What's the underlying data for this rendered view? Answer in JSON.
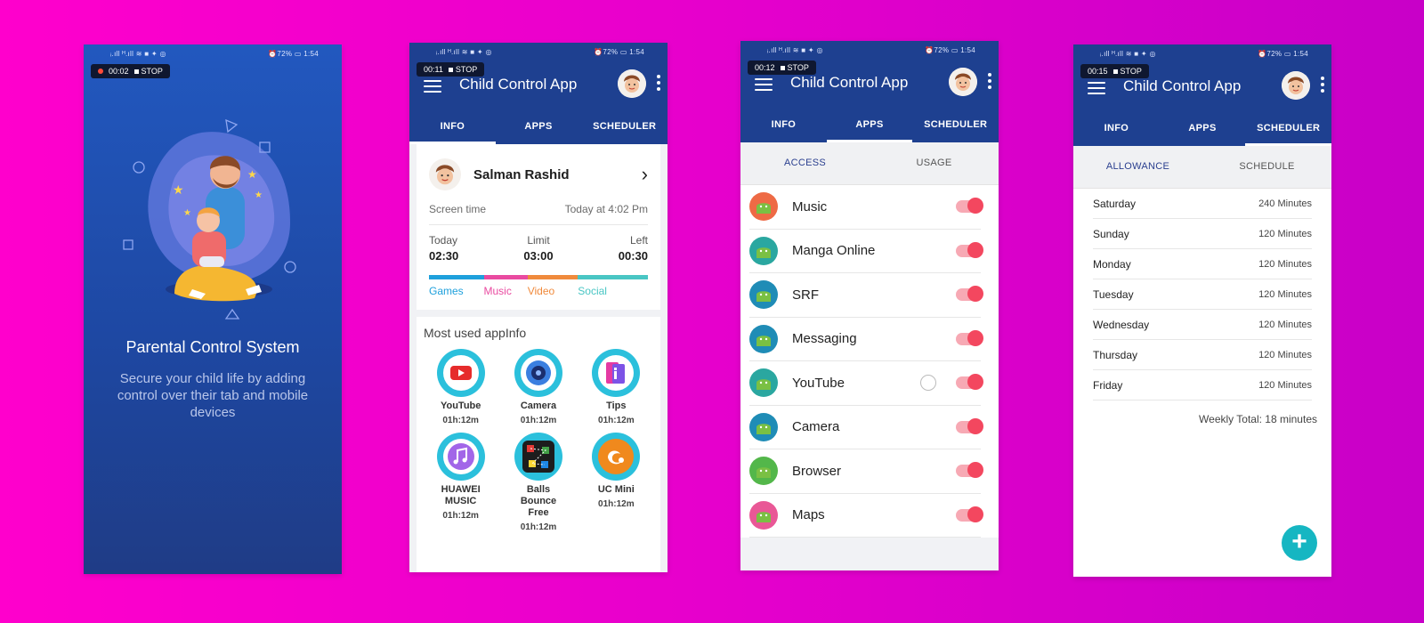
{
  "status_bar": {
    "left_icons": "ᵢ.ıll ᴴ.ıll ≋ ■ ✦ ◎",
    "battery": "⏰72% ▭ 1:54"
  },
  "screens": {
    "splash": {
      "recording": {
        "time": "00:02",
        "stop": "STOP"
      },
      "title": "Parental Control System",
      "subtitle": "Secure your child life by adding control over their tab and mobile devices"
    },
    "info": {
      "recording": {
        "time": "00:11",
        "stop": "STOP"
      },
      "app_title": "Child Control App",
      "tabs": [
        "INFO",
        "APPS",
        "SCHEDULER"
      ],
      "profile_name": "Salman Rashid",
      "screen_time_label": "Screen time",
      "screen_time_value": "Today at 4:02 Pm",
      "usage": {
        "today_label": "Today",
        "today_value": "02:30",
        "limit_label": "Limit",
        "limit_value": "03:00",
        "left_label": "Left",
        "left_value": "00:30"
      },
      "categories": [
        {
          "label": "Games",
          "color": "#1ea0dc"
        },
        {
          "label": "Music",
          "color": "#e94aa0"
        },
        {
          "label": "Video",
          "color": "#f08a3c"
        },
        {
          "label": "Social",
          "color": "#49c6c4"
        }
      ],
      "most_used_title": "Most used appInfo",
      "apps": [
        {
          "name": "YouTube",
          "time": "01h:12m",
          "icon": "youtube-icon"
        },
        {
          "name": "Camera",
          "time": "01h:12m",
          "icon": "camera-icon"
        },
        {
          "name": "Tips",
          "time": "01h:12m",
          "icon": "tips-icon"
        },
        {
          "name": "HUAWEI MUSIC",
          "time": "01h:12m",
          "icon": "music-icon"
        },
        {
          "name": "Balls Bounce Free",
          "time": "01h:12m",
          "icon": "balls-icon"
        },
        {
          "name": "UC Mini",
          "time": "01h:12m",
          "icon": "uc-mini-icon"
        }
      ]
    },
    "apps": {
      "recording": {
        "time": "00:12",
        "stop": "STOP"
      },
      "app_title": "Child Control App",
      "tabs": [
        "INFO",
        "APPS",
        "SCHEDULER"
      ],
      "subtabs": [
        "ACCESS",
        "USAGE"
      ],
      "list": [
        {
          "name": "Music",
          "color": "#ee6a45"
        },
        {
          "name": "Manga Online",
          "color": "#2aa7a0"
        },
        {
          "name": "SRF",
          "color": "#1f8cb6"
        },
        {
          "name": "Messaging",
          "color": "#1f8cb6"
        },
        {
          "name": "YouTube",
          "color": "#2aa7a0"
        },
        {
          "name": "Camera",
          "color": "#1f8cb6"
        },
        {
          "name": "Browser",
          "color": "#53b74a"
        },
        {
          "name": "Maps",
          "color": "#e95896"
        }
      ]
    },
    "scheduler": {
      "recording": {
        "time": "00:15",
        "stop": "STOP"
      },
      "app_title": "Child Control App",
      "tabs": [
        "INFO",
        "APPS",
        "SCHEDULER"
      ],
      "subtabs": [
        "ALLOWANCE",
        "SCHEDULE"
      ],
      "days": [
        {
          "day": "Saturday",
          "value": "240 Minutes"
        },
        {
          "day": "Sunday",
          "value": "120 Minutes"
        },
        {
          "day": "Monday",
          "value": "120 Minutes"
        },
        {
          "day": "Tuesday",
          "value": "120 Minutes"
        },
        {
          "day": "Wednesday",
          "value": "120 Minutes"
        },
        {
          "day": "Thursday",
          "value": "120 Minutes"
        },
        {
          "day": "Friday",
          "value": "120 Minutes"
        }
      ],
      "weekly_total": "Weekly Total: 18 minutes",
      "fab": "+"
    }
  }
}
